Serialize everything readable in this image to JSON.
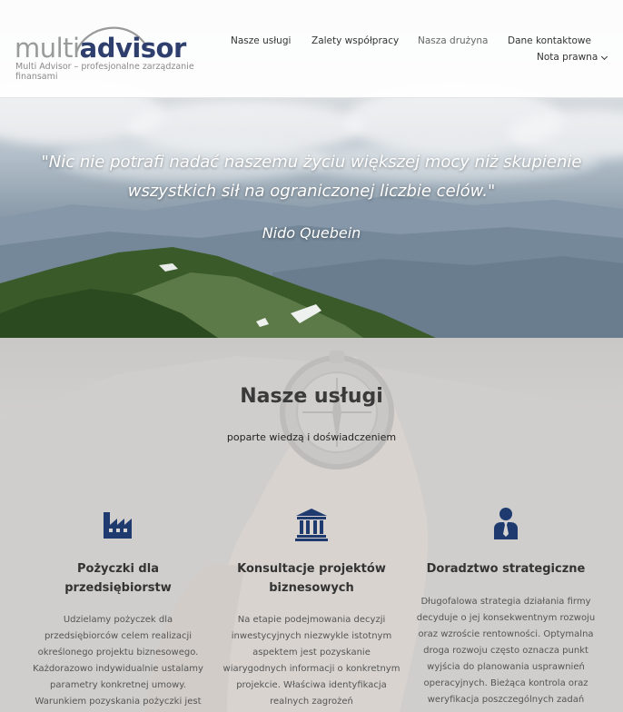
{
  "header": {
    "logo_light": "multi",
    "logo_bold": "advisor",
    "tagline": "Multi Advisor – profesjonalne zarządzanie finansami"
  },
  "nav": {
    "items": [
      {
        "label": "Nasze usługi"
      },
      {
        "label": "Zalety współpracy"
      },
      {
        "label": "Nasza drużyna",
        "active": true
      },
      {
        "label": "Dane kontaktowe"
      },
      {
        "label": "Nota prawna",
        "has_dropdown": true
      }
    ]
  },
  "hero": {
    "quote": "\"Nic nie potrafi nadać naszemu życiu większej mocy niż skupienie wszystkich sił na ograniczonej liczbie celów.\"",
    "author": "Nido Quebein"
  },
  "services": {
    "title": "Nasze usługi",
    "subtitle": "poparte wiedzą i doświadczeniem",
    "items": [
      {
        "icon": "factory-icon",
        "title": "Pożyczki dla przedsiębiorstw",
        "text": "Udzielamy pożyczek dla przedsiębiorców celem realizacji określonego projektu biznesowego. Każdorazowo indywidualnie ustalamy parametry konkretnej umowy. Warunkiem pozyskania pożyczki jest"
      },
      {
        "icon": "bank-building-icon",
        "title": "Konsultacje projektów biznesowych",
        "text": "Na etapie podejmowania decyzji inwestycyjnych niezwykle istotnym aspektem jest pozyskanie wiarygodnych informacji o konkretnym projekcie. Właściwa identyfikacja realnych zagrożeń"
      },
      {
        "icon": "businessman-icon",
        "title": "Doradztwo strategiczne",
        "text": "Długofalowa strategia działania firmy decyduje o jej konsekwentnym rozwoju oraz wzroście rentowności. Optymalna droga rozwoju często oznacza punkt wyjścia do planowania usprawnień operacyjnych. Bieżąca kontrola oraz weryfikacja poszczególnych zadań"
      }
    ]
  },
  "colors": {
    "brand_navy": "#2e3f6e",
    "logo_gray": "#9a9a9a",
    "icon_blue": "#1f3a6e"
  }
}
